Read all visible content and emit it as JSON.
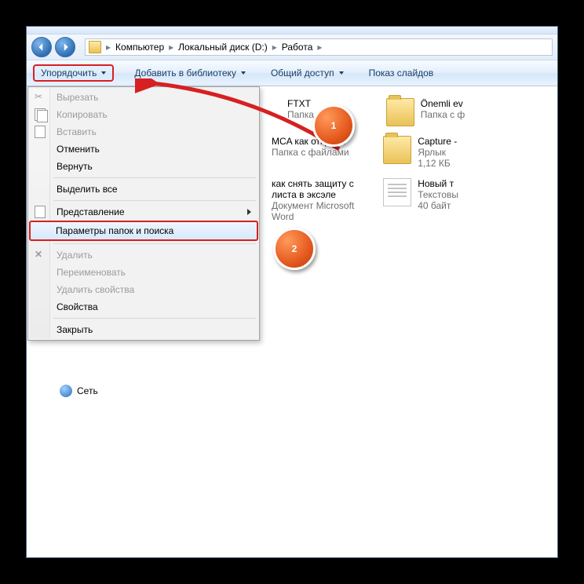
{
  "breadcrumb": {
    "root": "Компьютер",
    "drive": "Локальный диск (D:)",
    "folder": "Работа"
  },
  "toolbar": {
    "organize": "Упорядочить",
    "add_library": "Добавить в библиотеку",
    "share": "Общий доступ",
    "slideshow": "Показ слайдов"
  },
  "menu": {
    "cut": "Вырезать",
    "copy": "Копировать",
    "paste": "Вставить",
    "undo": "Отменить",
    "redo": "Вернуть",
    "select_all": "Выделить все",
    "view": "Представление",
    "folder_options": "Параметры папок и поиска",
    "delete": "Удалить",
    "rename": "Переименовать",
    "remove_props": "Удалить свойства",
    "properties": "Свойства",
    "close": "Закрыть"
  },
  "files": {
    "r1c1_title": "FTXT",
    "r1c1_sub": "Папка",
    "r1c2_title": "Önemli ev",
    "r1c2_sub": "Папка с ф",
    "r2c1_title": "MCA как открыть",
    "r2c1_sub": "Папка с файлами",
    "r2c2_title": "Capture -",
    "r2c2_sub": "Ярлык",
    "r2c2_sub2": "1,12 КБ",
    "r3c1_title": "как снять защиту с листа в эксэле",
    "r3c1_sub": "Документ Microsoft Word",
    "r3c2_title": "Новый т",
    "r3c2_sub": "Текстовы",
    "r3c2_sub2": "40 байт"
  },
  "sidebar": {
    "network": "Сеть"
  },
  "annotations": {
    "badge1": "1",
    "badge2": "2"
  }
}
